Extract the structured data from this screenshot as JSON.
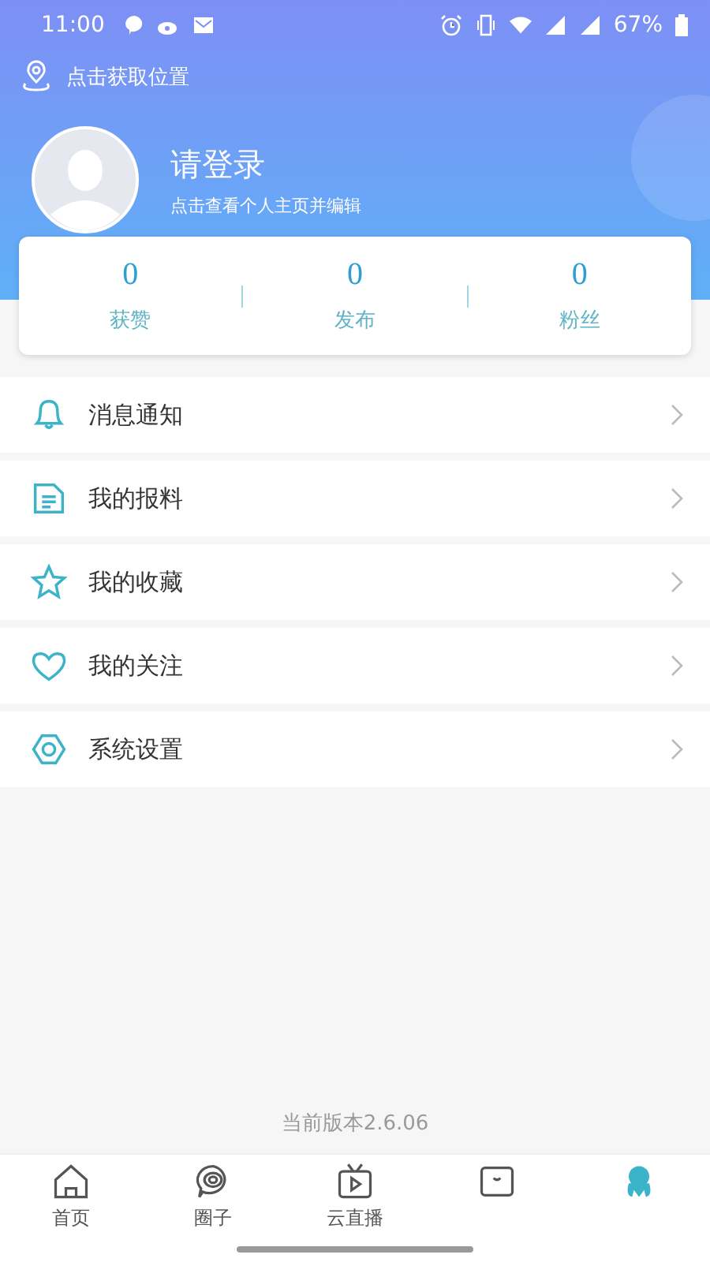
{
  "status_bar": {
    "time": "11:00",
    "battery": "67%"
  },
  "location": {
    "label": "点击获取位置"
  },
  "profile": {
    "name": "请登录",
    "subtitle": "点击查看个人主页并编辑"
  },
  "stats": [
    {
      "value": "0",
      "label": "获赞"
    },
    {
      "value": "0",
      "label": "发布"
    },
    {
      "value": "0",
      "label": "粉丝"
    }
  ],
  "menu": [
    {
      "kind": "bell",
      "label": "消息通知"
    },
    {
      "kind": "document",
      "label": "我的报料"
    },
    {
      "kind": "star",
      "label": "我的收藏"
    },
    {
      "kind": "heart",
      "label": "我的关注"
    },
    {
      "kind": "gear",
      "label": "系统设置"
    }
  ],
  "version": "当前版本2.6.06",
  "tabs": [
    {
      "kind": "home",
      "label": "首页",
      "selected": false
    },
    {
      "kind": "circle",
      "label": "圈子",
      "selected": false
    },
    {
      "kind": "tv",
      "label": "云直播",
      "selected": false
    },
    {
      "kind": "box",
      "selected": false
    },
    {
      "kind": "person",
      "selected": true
    }
  ]
}
